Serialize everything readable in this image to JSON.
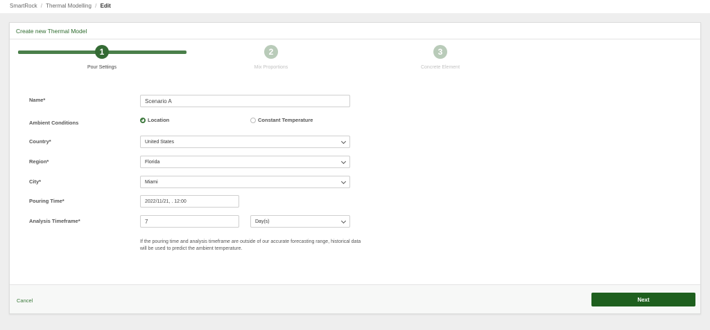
{
  "breadcrumb": {
    "items": [
      "SmartRock",
      "Thermal Modelling"
    ],
    "current": "Edit",
    "separator": "/"
  },
  "card": {
    "title": "Create new Thermal Model"
  },
  "stepper": {
    "steps": [
      {
        "number": "1",
        "label": "Pour Settings",
        "state": "active"
      },
      {
        "number": "2",
        "label": "Mix Proportions",
        "state": "inactive"
      },
      {
        "number": "3",
        "label": "Concrete Element",
        "state": "inactive"
      }
    ]
  },
  "form": {
    "name": {
      "label": "Name*",
      "value": "Scenario A"
    },
    "ambient": {
      "label": "Ambient Conditions",
      "options": [
        {
          "label": "Location",
          "checked": true
        },
        {
          "label": "Constant Temperature",
          "checked": false
        }
      ]
    },
    "country": {
      "label": "Country*",
      "value": "United States"
    },
    "region": {
      "label": "Region*",
      "value": "Florida"
    },
    "city": {
      "label": "City*",
      "value": "Miami"
    },
    "pouring_time": {
      "label": "Pouring Time*",
      "value": "2022/11/21, . 12:00"
    },
    "analysis_timeframe": {
      "label": "Analysis Timeframe*",
      "value": "7",
      "unit": "Day(s)"
    },
    "help_text": "If the pouring time and analysis timeframe are outside of our accurate forecasting range, historical data will be used to predict the ambient temperature."
  },
  "footer": {
    "cancel_label": "Cancel",
    "next_label": "Next"
  },
  "colors": {
    "accent": "#356b35",
    "button": "#1e5f1e",
    "step_inactive": "#b9cbb9",
    "background": "#eeeeee"
  }
}
